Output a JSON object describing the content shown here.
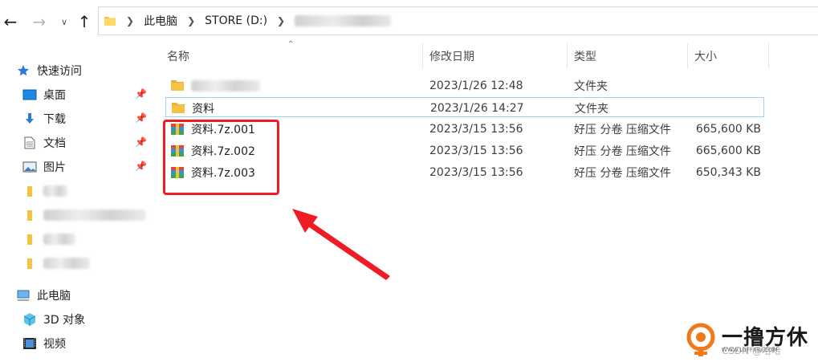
{
  "address": {
    "crumbs": [
      "此电脑",
      "STORE (D:)"
    ]
  },
  "sidebar": {
    "quick_access": "快速访问",
    "items": [
      {
        "label": "桌面",
        "icon": "desktop-icon",
        "pinned": true
      },
      {
        "label": "下载",
        "icon": "download-icon",
        "pinned": true
      },
      {
        "label": "文档",
        "icon": "document-icon",
        "pinned": true
      },
      {
        "label": "图片",
        "icon": "picture-icon",
        "pinned": true
      }
    ],
    "this_pc": "此电脑",
    "pc_items": [
      {
        "label": "3D 对象",
        "icon": "3d-objects-icon"
      },
      {
        "label": "视频",
        "icon": "video-icon"
      }
    ]
  },
  "columns": {
    "name": "名称",
    "date": "修改日期",
    "type": "类型",
    "size": "大小"
  },
  "files": [
    {
      "name": "",
      "date": "2023/1/26 12:48",
      "type": "文件夹",
      "size": "",
      "icon": "folder-icon",
      "redacted": true
    },
    {
      "name": "资料",
      "date": "2023/1/26 14:27",
      "type": "文件夹",
      "size": "",
      "icon": "folder-icon",
      "selected": true
    },
    {
      "name": "资料.7z.001",
      "date": "2023/3/15 13:56",
      "type": "好压 分卷 压缩文件",
      "size": "665,600 KB",
      "icon": "archive-icon"
    },
    {
      "name": "资料.7z.002",
      "date": "2023/3/15 13:56",
      "type": "好压 分卷 压缩文件",
      "size": "665,600 KB",
      "icon": "archive-icon"
    },
    {
      "name": "资料.7z.003",
      "date": "2023/3/15 13:56",
      "type": "好压 分卷 压缩文件",
      "size": "650,343 KB",
      "icon": "archive-icon"
    }
  ],
  "watermark": {
    "title": "一撸方休",
    "subtitle": "WWW.LUFFXIU.COM",
    "csdn": "CSDN @哈哈"
  },
  "colors": {
    "annotation": "#ee1c25",
    "folder": "#f5c342",
    "selection_border": "#99d1ff",
    "quick_access_star": "#2b7bd6",
    "watermark_orange": "#f07a1a"
  }
}
